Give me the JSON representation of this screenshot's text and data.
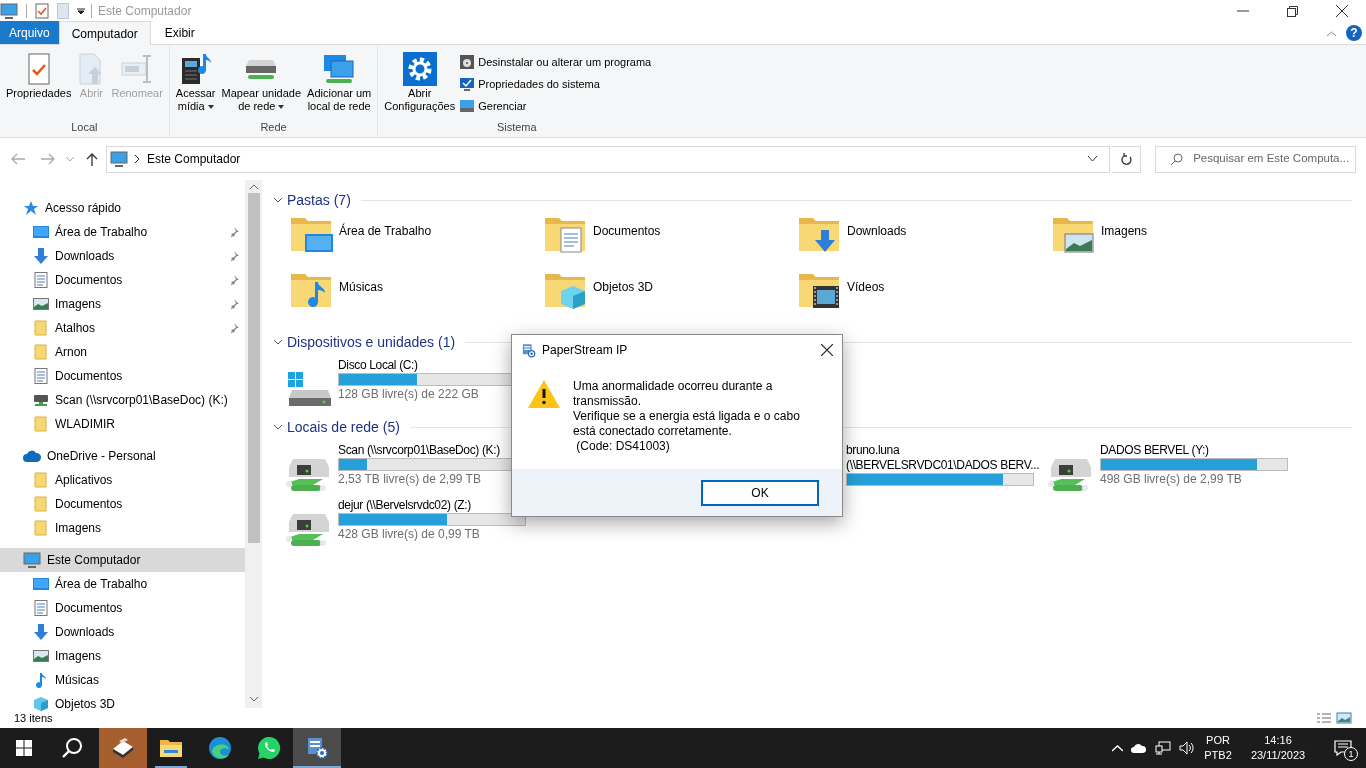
{
  "window": {
    "title": "Este Computador"
  },
  "ribbon_tabs": [
    {
      "label": "Arquivo",
      "kind": "file"
    },
    {
      "label": "Computador",
      "kind": "tab",
      "selected": true
    },
    {
      "label": "Exibir",
      "kind": "tab",
      "selected": false
    }
  ],
  "help_label": "?",
  "ribbon_groups": [
    {
      "label": "Local",
      "buttons": [
        {
          "kind": "properties",
          "lines": [
            "Propriedades"
          ],
          "disabled": false,
          "dropdown": false
        },
        {
          "kind": "open",
          "lines": [
            "Abrir"
          ],
          "disabled": true,
          "dropdown": false
        },
        {
          "kind": "rename",
          "lines": [
            "Renomear"
          ],
          "disabled": true,
          "dropdown": false
        }
      ]
    },
    {
      "label": "Rede",
      "buttons": [
        {
          "kind": "media",
          "lines": [
            "Acessar",
            "mídia"
          ],
          "disabled": false,
          "dropdown": true
        },
        {
          "kind": "map-drive",
          "lines": [
            "Mapear unidade",
            "de rede"
          ],
          "disabled": false,
          "dropdown": true
        },
        {
          "kind": "add-location",
          "lines": [
            "Adicionar um",
            "local de rede"
          ],
          "disabled": false,
          "dropdown": false
        }
      ]
    },
    {
      "label": "Sistema",
      "buttons": [
        {
          "kind": "settings",
          "lines": [
            "Abrir",
            "Configurações"
          ],
          "disabled": false,
          "dropdown": false
        }
      ],
      "small_buttons": [
        {
          "kind": "uninstall",
          "label": "Desinstalar ou alterar um programa"
        },
        {
          "kind": "system",
          "label": "Propriedades do sistema"
        },
        {
          "kind": "manage",
          "label": "Gerenciar"
        }
      ]
    }
  ],
  "address": {
    "path": "Este Computador",
    "search_placeholder": "Pesquisar em Este Computa..."
  },
  "sidebar": [
    {
      "label": "Acesso rápido",
      "kind": "star",
      "selected": false,
      "children": [
        {
          "label": "Área de Trabalho",
          "kind": "desktop",
          "pinned": true,
          "selected": false
        },
        {
          "label": "Downloads",
          "kind": "downloads",
          "pinned": true,
          "selected": false
        },
        {
          "label": "Documentos",
          "kind": "documents",
          "pinned": true,
          "selected": false
        },
        {
          "label": "Imagens",
          "kind": "images",
          "pinned": true,
          "selected": false
        },
        {
          "label": "Atalhos",
          "kind": "folder",
          "pinned": true,
          "selected": false
        },
        {
          "label": "Arnon",
          "kind": "folder",
          "pinned": false,
          "selected": false
        },
        {
          "label": "Documentos",
          "kind": "documents",
          "pinned": false,
          "selected": false
        },
        {
          "label": "Scan (\\\\srvcorp01\\BaseDoc) (K:)",
          "kind": "netdrive",
          "pinned": false,
          "selected": false
        },
        {
          "label": "WLADIMIR",
          "kind": "folder",
          "pinned": false,
          "selected": false
        }
      ]
    },
    {
      "label": "OneDrive - Personal",
      "kind": "cloud",
      "selected": false,
      "children": [
        {
          "label": "Aplicativos",
          "kind": "folder",
          "selected": false
        },
        {
          "label": "Documentos",
          "kind": "folder",
          "selected": false
        },
        {
          "label": "Imagens",
          "kind": "folder",
          "selected": false
        }
      ]
    },
    {
      "label": "Este Computador",
      "kind": "computer",
      "selected": true,
      "children": [
        {
          "label": "Área de Trabalho",
          "kind": "desktop",
          "selected": false
        },
        {
          "label": "Documentos",
          "kind": "documents",
          "selected": false
        },
        {
          "label": "Downloads",
          "kind": "downloads",
          "selected": false
        },
        {
          "label": "Imagens",
          "kind": "images",
          "selected": false
        },
        {
          "label": "Músicas",
          "kind": "music",
          "selected": false
        },
        {
          "label": "Objetos 3D",
          "kind": "objects3d",
          "selected": false
        }
      ]
    }
  ],
  "sections": [
    {
      "title": "Pastas (7)",
      "kind": "folders",
      "expanded": true,
      "items": [
        {
          "name": "Área de Trabalho",
          "kind": "desktop"
        },
        {
          "name": "Documentos",
          "kind": "documents"
        },
        {
          "name": "Downloads",
          "kind": "downloads"
        },
        {
          "name": "Imagens",
          "kind": "images"
        },
        {
          "name": "Músicas",
          "kind": "music"
        },
        {
          "name": "Objetos 3D",
          "kind": "objects3d"
        },
        {
          "name": "Vídeos",
          "kind": "videos"
        }
      ]
    },
    {
      "title": "Dispositivos e unidades (1)",
      "kind": "drives",
      "expanded": true,
      "items": [
        {
          "name": "Disco Local (C:)",
          "kind": "local",
          "level": 0.42,
          "free": "128 GB livre(s) de 222 GB"
        }
      ]
    },
    {
      "title": "Locais de rede (5)",
      "kind": "network",
      "expanded": true,
      "items": [
        {
          "name": "Scan (\\\\srvcorp01\\BaseDoc) (K:)",
          "kind": "network",
          "level": 0.15,
          "free": "2,53 TB livre(s) de 2,99 TB"
        },
        {
          "name": "bruno.luna (\\\\BERVELSRVDC01\\DADOS BERV...",
          "level": 0.84
        },
        {
          "name": "DADOS BERVEL (Y:)",
          "kind": "network",
          "level": 0.84,
          "free": "498 GB livre(s) de 2,99 TB"
        },
        {
          "name": "dejur (\\\\Bervelsrvdc02) (Z:)",
          "kind": "network",
          "level": 0.58,
          "free": "428 GB livre(s) de 0,99 TB"
        }
      ]
    }
  ],
  "status_bar": {
    "count": "13 itens"
  },
  "dialog": {
    "title": "PaperStream IP",
    "message": [
      "Uma anormalidade ocorreu durante a transmissão.",
      "Verifique se a energia está ligada e o cabo está conectado corretamente.",
      " (Code: DS41003)"
    ],
    "button": "OK"
  },
  "taskbar": {
    "apps": [
      {
        "kind": "capture",
        "open": false,
        "active": false,
        "flashing": true
      },
      {
        "kind": "explorer",
        "open": true,
        "active": false,
        "flashing": false
      },
      {
        "kind": "edge",
        "open": false,
        "active": false,
        "flashing": false
      },
      {
        "kind": "whatsapp",
        "open": false,
        "active": false,
        "flashing": false
      },
      {
        "kind": "paperstream",
        "open": true,
        "active": true,
        "flashing": false
      }
    ],
    "language": "POR",
    "layout": "PTB2",
    "time": "14:16",
    "date": "23/11/2023",
    "notifications": "1"
  }
}
